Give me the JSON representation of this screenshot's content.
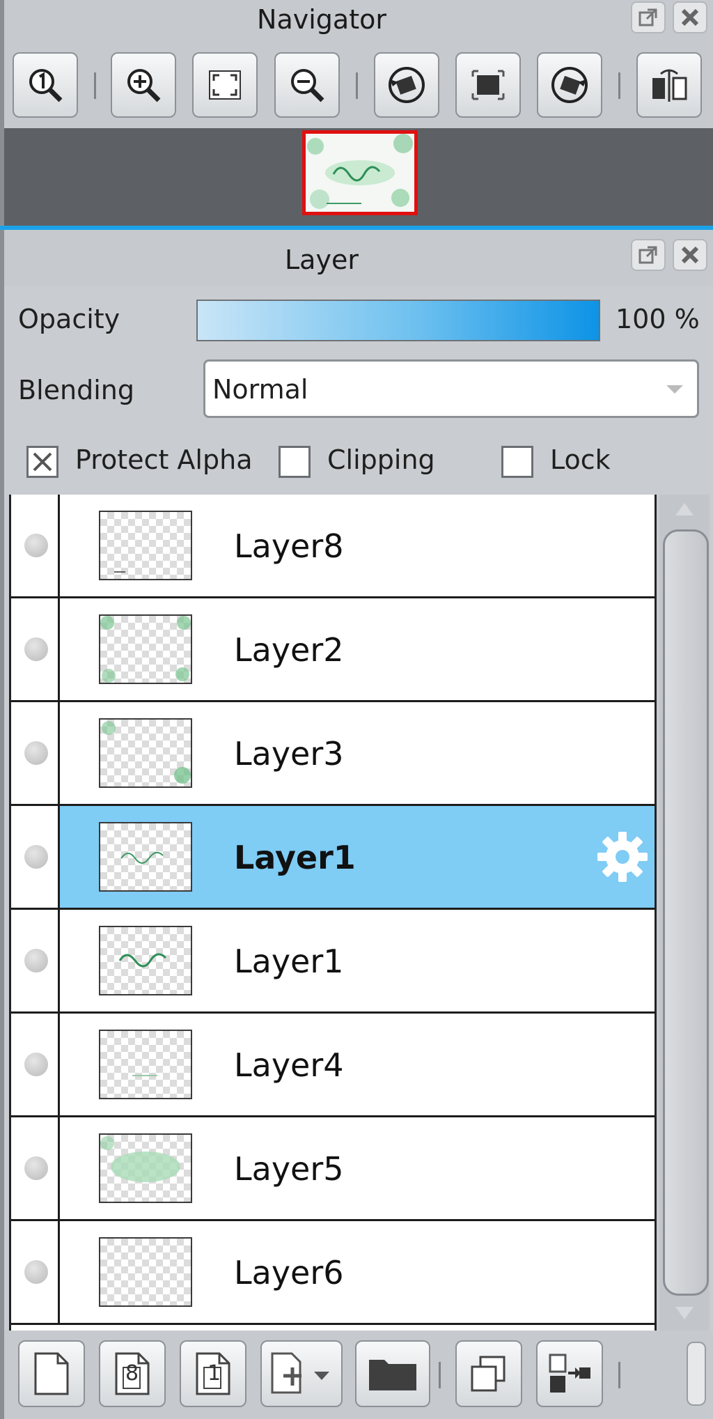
{
  "navigator": {
    "title": "Navigator",
    "toolbar": [
      {
        "icon": "zoom-actual-size-icon"
      },
      {
        "icon": "zoom-in-icon"
      },
      {
        "icon": "fit-to-window-icon"
      },
      {
        "icon": "zoom-out-icon"
      },
      {
        "icon": "rotate-left-icon"
      },
      {
        "icon": "reset-rotation-icon"
      },
      {
        "icon": "rotate-right-icon"
      },
      {
        "icon": "flip-horizontal-icon"
      }
    ]
  },
  "layer_panel": {
    "title": "Layer",
    "opacity_label": "Opacity",
    "opacity_value": "100 %",
    "opacity_level": 1.0,
    "blending_label": "Blending",
    "blending_value": "Normal",
    "protect_alpha_label": "Protect Alpha",
    "protect_alpha_checked": true,
    "clipping_label": "Clipping",
    "clipping_checked": false,
    "lock_label": "Lock",
    "lock_checked": false,
    "layers": [
      {
        "name": "Layer8",
        "selected": false
      },
      {
        "name": "Layer2",
        "selected": false
      },
      {
        "name": "Layer3",
        "selected": false
      },
      {
        "name": "Layer1",
        "selected": true
      },
      {
        "name": "Layer1",
        "selected": false
      },
      {
        "name": "Layer4",
        "selected": false
      },
      {
        "name": "Layer5",
        "selected": false
      },
      {
        "name": "Layer6",
        "selected": false
      }
    ],
    "bottom_tools": [
      {
        "icon": "new-layer-icon"
      },
      {
        "icon": "new-8bit-layer-icon",
        "text": "8"
      },
      {
        "icon": "new-1bit-layer-icon",
        "text": "1"
      },
      {
        "icon": "add-layer-dropdown-icon"
      },
      {
        "icon": "new-folder-icon"
      },
      {
        "icon": "duplicate-layer-icon"
      },
      {
        "icon": "merge-down-icon"
      }
    ]
  },
  "colors": {
    "accent": "#1aa3e8",
    "selected_row": "#7fccf5",
    "preview_border": "#e01010"
  }
}
